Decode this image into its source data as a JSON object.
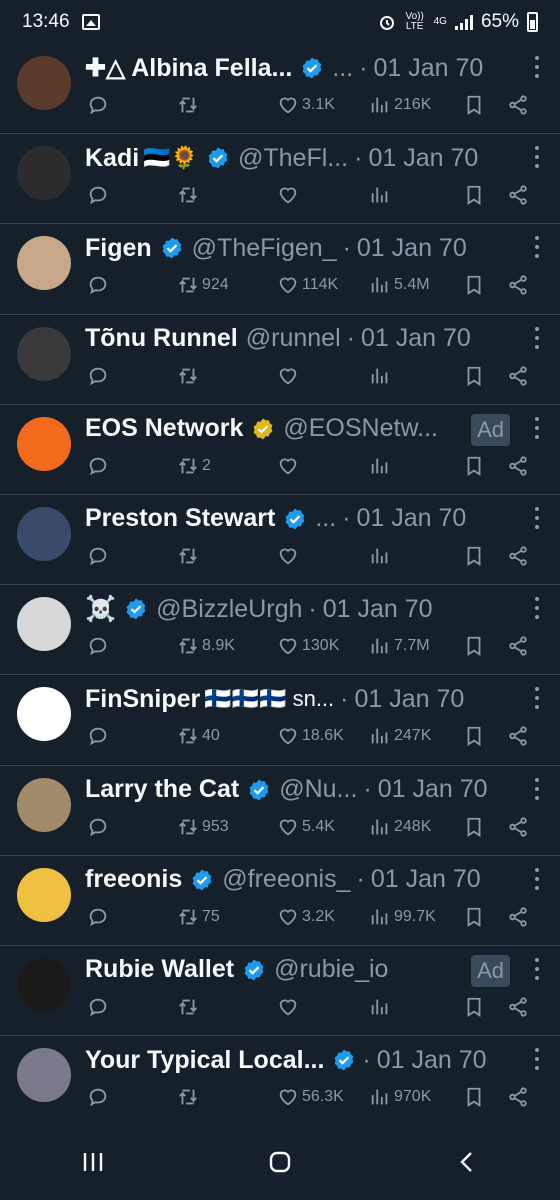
{
  "status_bar": {
    "time": "13:46",
    "volte": "Vo)) LTE",
    "network": "4G",
    "battery": "65%"
  },
  "colors": {
    "background": "#15202b",
    "verified_blue": "#1d9bf0",
    "verified_gold": "#e2b719",
    "muted": "#8b98a5"
  },
  "tweets": [
    {
      "name": "✚△ Albina Fella...",
      "emoji": "",
      "verified": "blue",
      "handle": "...",
      "sep": "·",
      "date": "01 Jan 70",
      "ad": "",
      "retweets": "",
      "likes": "3.1K",
      "views": "216K"
    },
    {
      "name": "Kadi",
      "emoji": "🇪🇪🌻",
      "verified": "blue",
      "handle": "@TheFl...",
      "sep": "·",
      "date": "01 Jan 70",
      "ad": "",
      "retweets": "",
      "likes": "",
      "views": ""
    },
    {
      "name": "Figen",
      "emoji": "",
      "verified": "blue",
      "handle": "@TheFigen_",
      "sep": "·",
      "date": "01 Jan 70",
      "ad": "",
      "retweets": "924",
      "likes": "114K",
      "views": "5.4M"
    },
    {
      "name": "Tõnu Runnel",
      "emoji": "",
      "verified": "",
      "handle": "@runnel",
      "sep": "·",
      "date": "01 Jan 70",
      "ad": "",
      "retweets": "",
      "likes": "",
      "views": ""
    },
    {
      "name": "EOS Network",
      "emoji": "",
      "verified": "gold",
      "handle": "@EOSNetw...",
      "sep": "",
      "date": "",
      "ad": "Ad",
      "retweets": "2",
      "likes": "",
      "views": ""
    },
    {
      "name": "Preston Stewart",
      "emoji": "",
      "verified": "blue",
      "handle": "...",
      "sep": "·",
      "date": "01 Jan 70",
      "ad": "",
      "retweets": "",
      "likes": "",
      "views": ""
    },
    {
      "name": "☠️",
      "emoji": "",
      "verified": "blue",
      "handle": "@BizzleUrgh",
      "sep": "·",
      "date": "01 Jan 70",
      "ad": "",
      "retweets": "8.9K",
      "likes": "130K",
      "views": "7.7M"
    },
    {
      "name": "FinSniper",
      "emoji": "🇫🇮🇫🇮🇫🇮 sn...",
      "verified": "",
      "handle": "",
      "sep": "·",
      "date": "01 Jan 70",
      "ad": "",
      "retweets": "40",
      "likes": "18.6K",
      "views": "247K"
    },
    {
      "name": "Larry the Cat",
      "emoji": "",
      "verified": "blue",
      "handle": "@Nu...",
      "sep": "·",
      "date": "01 Jan 70",
      "ad": "",
      "retweets": "953",
      "likes": "5.4K",
      "views": "248K"
    },
    {
      "name": "freeonis",
      "emoji": "",
      "verified": "blue",
      "handle": "@freeonis_",
      "sep": "·",
      "date": "01 Jan 70",
      "ad": "",
      "retweets": "75",
      "likes": "3.2K",
      "views": "99.7K"
    },
    {
      "name": "Rubie Wallet",
      "emoji": "",
      "verified": "blue",
      "handle": "@rubie_io",
      "sep": "",
      "date": "",
      "ad": "Ad",
      "retweets": "",
      "likes": "",
      "views": ""
    },
    {
      "name": "Your Typical Local...",
      "emoji": "",
      "verified": "blue",
      "handle": "",
      "sep": "·",
      "date": "01 Jan 70",
      "ad": "",
      "retweets": "",
      "likes": "56.3K",
      "views": "970K"
    }
  ],
  "avatars": [
    "#5a3a2a",
    "#2c2c2c",
    "#c9a88a",
    "#3a3a3a",
    "#f26b1d",
    "#3a4a6a",
    "#d8d8d8",
    "#ffffff",
    "#a08a6a",
    "#f0c040",
    "#1a1a1a",
    "#7a7a8a"
  ],
  "nav": [
    "recents-icon",
    "home-icon",
    "back-icon"
  ]
}
